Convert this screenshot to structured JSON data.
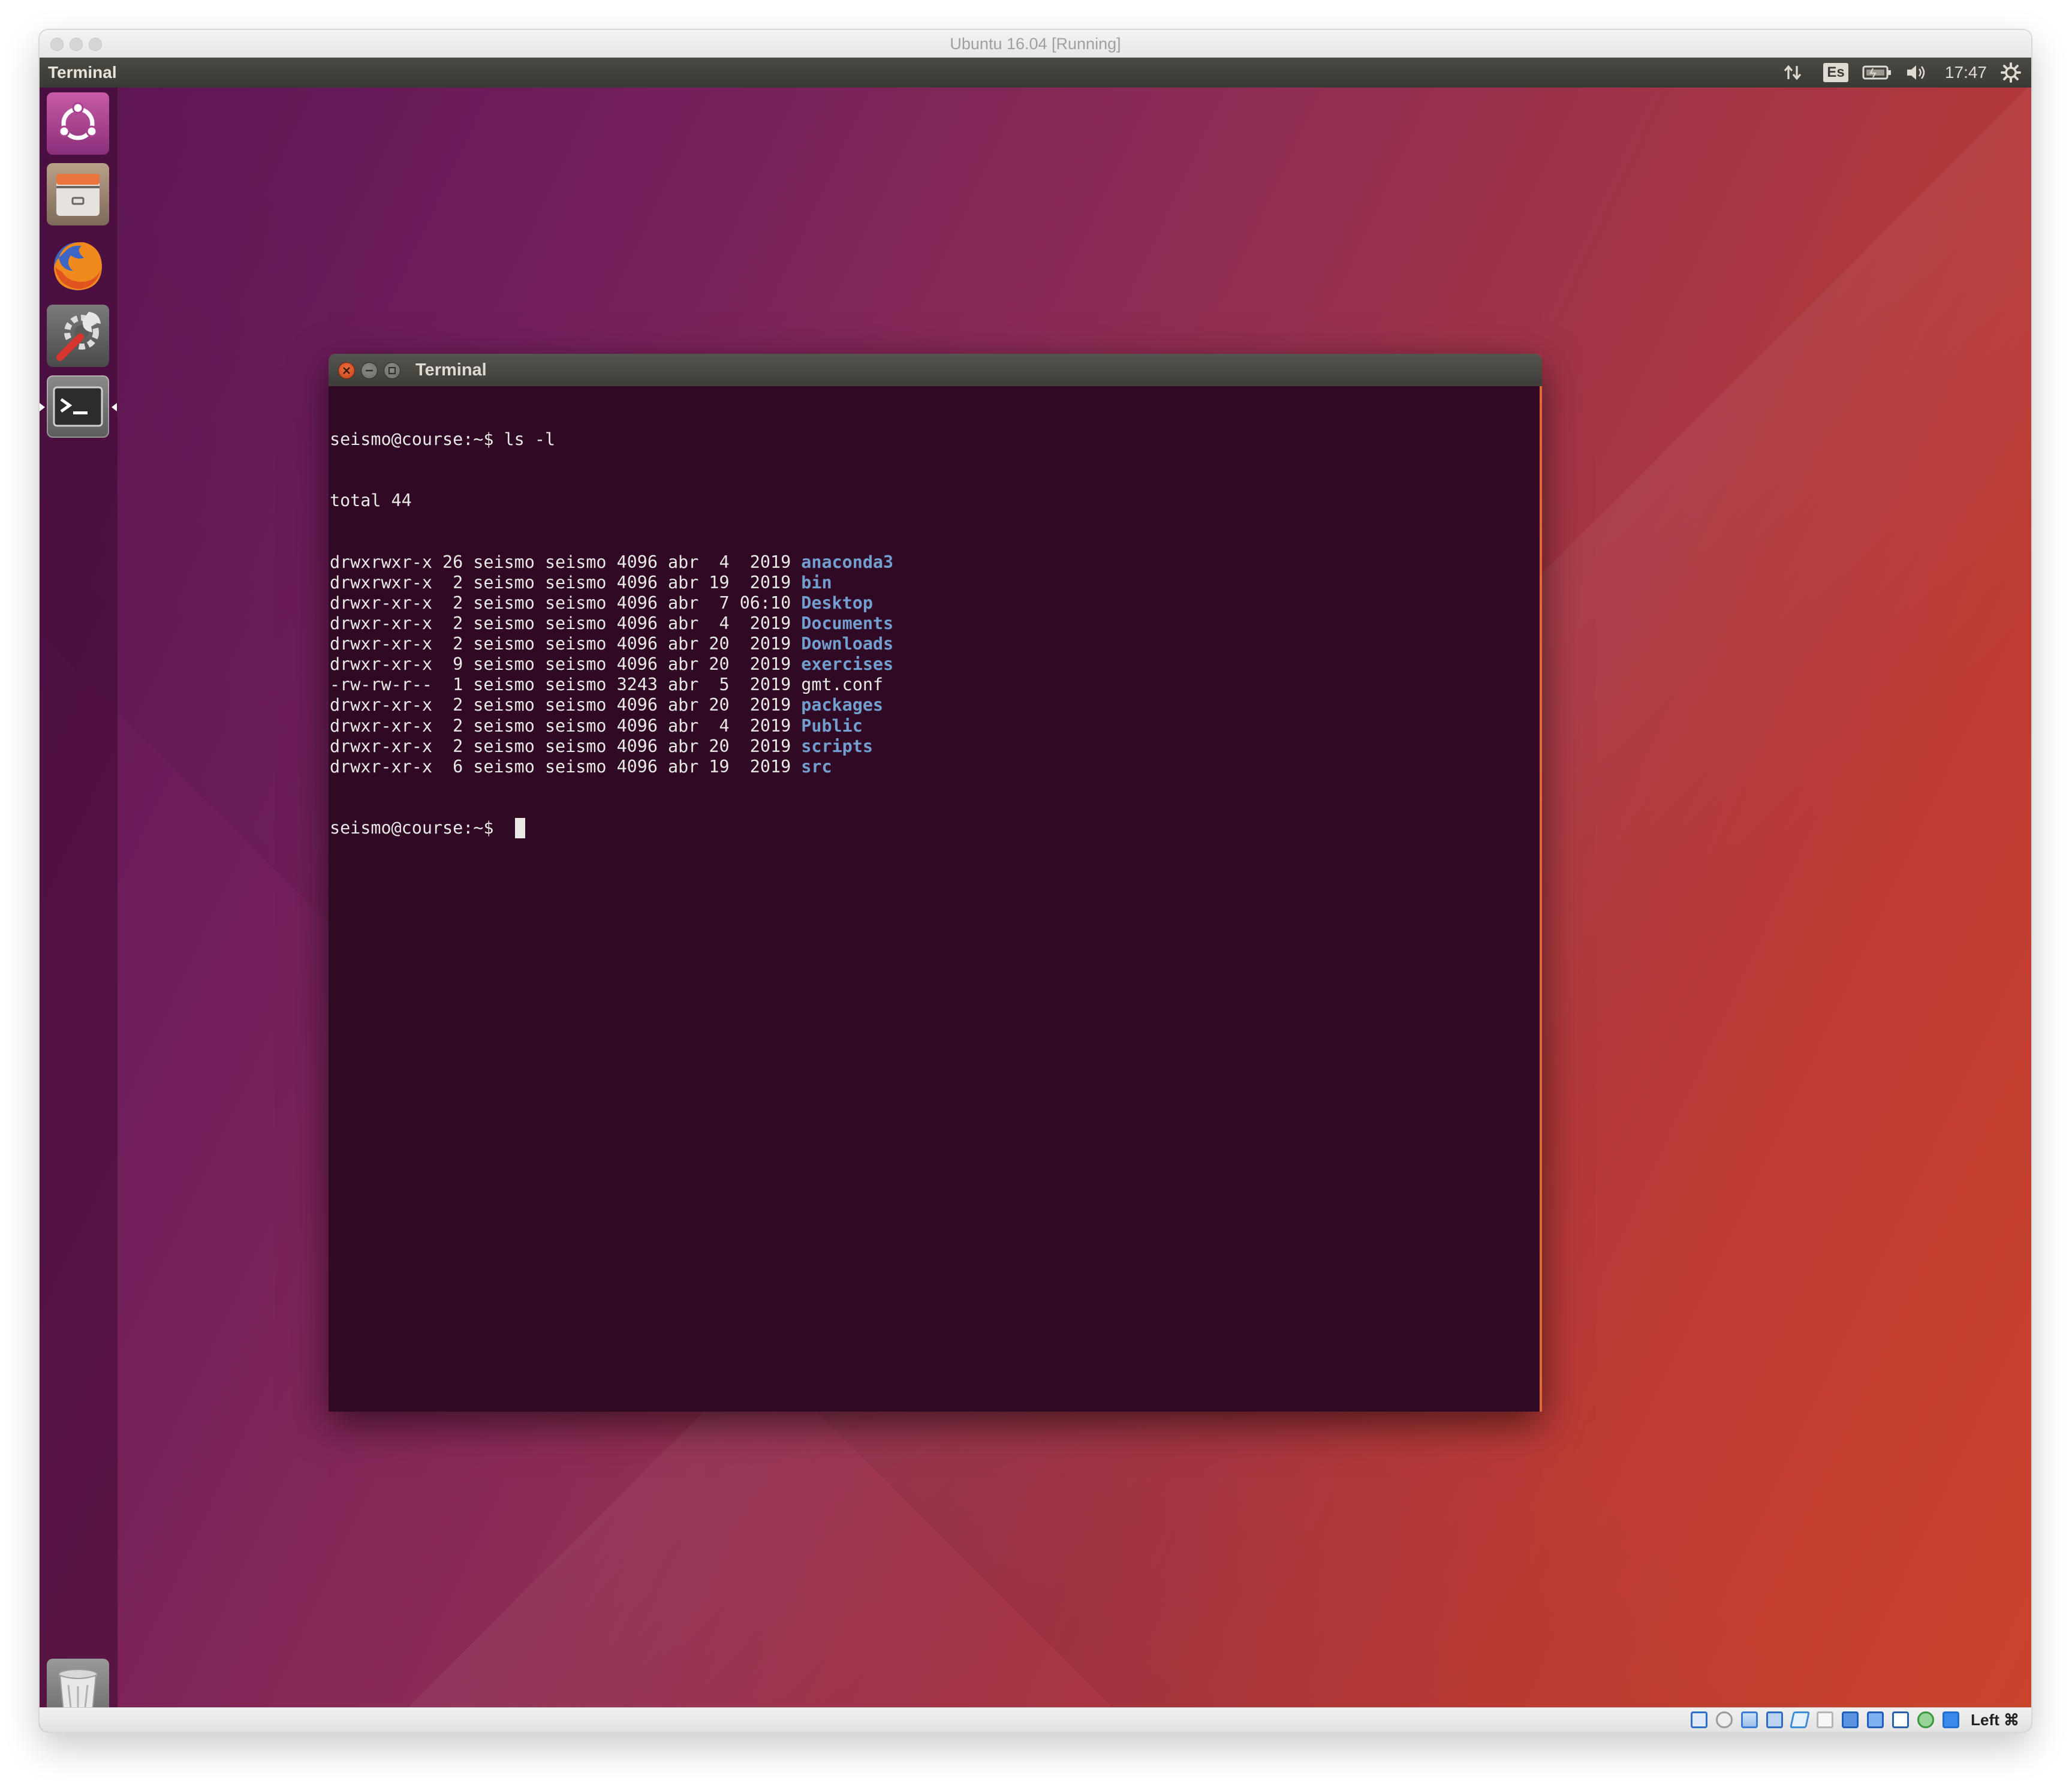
{
  "vbox": {
    "title": "Ubuntu 16.04 [Running]",
    "host_key": "Left ⌘"
  },
  "panel": {
    "app_name": "Terminal",
    "keyboard_layout": "Es",
    "clock": "17:47"
  },
  "launcher": {
    "items": [
      "dash-home",
      "files",
      "firefox",
      "system-settings",
      "terminal",
      "trash"
    ]
  },
  "terminal": {
    "title": "Terminal",
    "prompt": "seismo@course:~$ ",
    "command": "ls -l",
    "total": "total 44",
    "entries": [
      {
        "meta": "drwxrwxr-x 26 seismo seismo 4096 abr  4  2019 ",
        "name": "anaconda3",
        "is_dir": true
      },
      {
        "meta": "drwxrwxr-x  2 seismo seismo 4096 abr 19  2019 ",
        "name": "bin",
        "is_dir": true
      },
      {
        "meta": "drwxr-xr-x  2 seismo seismo 4096 abr  7 06:10 ",
        "name": "Desktop",
        "is_dir": true
      },
      {
        "meta": "drwxr-xr-x  2 seismo seismo 4096 abr  4  2019 ",
        "name": "Documents",
        "is_dir": true
      },
      {
        "meta": "drwxr-xr-x  2 seismo seismo 4096 abr 20  2019 ",
        "name": "Downloads",
        "is_dir": true
      },
      {
        "meta": "drwxr-xr-x  9 seismo seismo 4096 abr 20  2019 ",
        "name": "exercises",
        "is_dir": true
      },
      {
        "meta": "-rw-rw-r--  1 seismo seismo 3243 abr  5  2019 ",
        "name": "gmt.conf",
        "is_dir": false
      },
      {
        "meta": "drwxr-xr-x  2 seismo seismo 4096 abr 20  2019 ",
        "name": "packages",
        "is_dir": true
      },
      {
        "meta": "drwxr-xr-x  2 seismo seismo 4096 abr  4  2019 ",
        "name": "Public",
        "is_dir": true
      },
      {
        "meta": "drwxr-xr-x  2 seismo seismo 4096 abr 20  2019 ",
        "name": "scripts",
        "is_dir": true
      },
      {
        "meta": "drwxr-xr-x  6 seismo seismo 4096 abr 19  2019 ",
        "name": "src",
        "is_dir": true
      }
    ],
    "final_prompt": "seismo@course:~$ "
  },
  "colors": {
    "terminal_bg": "#300a24",
    "dir_blue": "#729fcf",
    "terminal_fg": "#e9e9e6",
    "accent_orange": "#e0683a"
  }
}
